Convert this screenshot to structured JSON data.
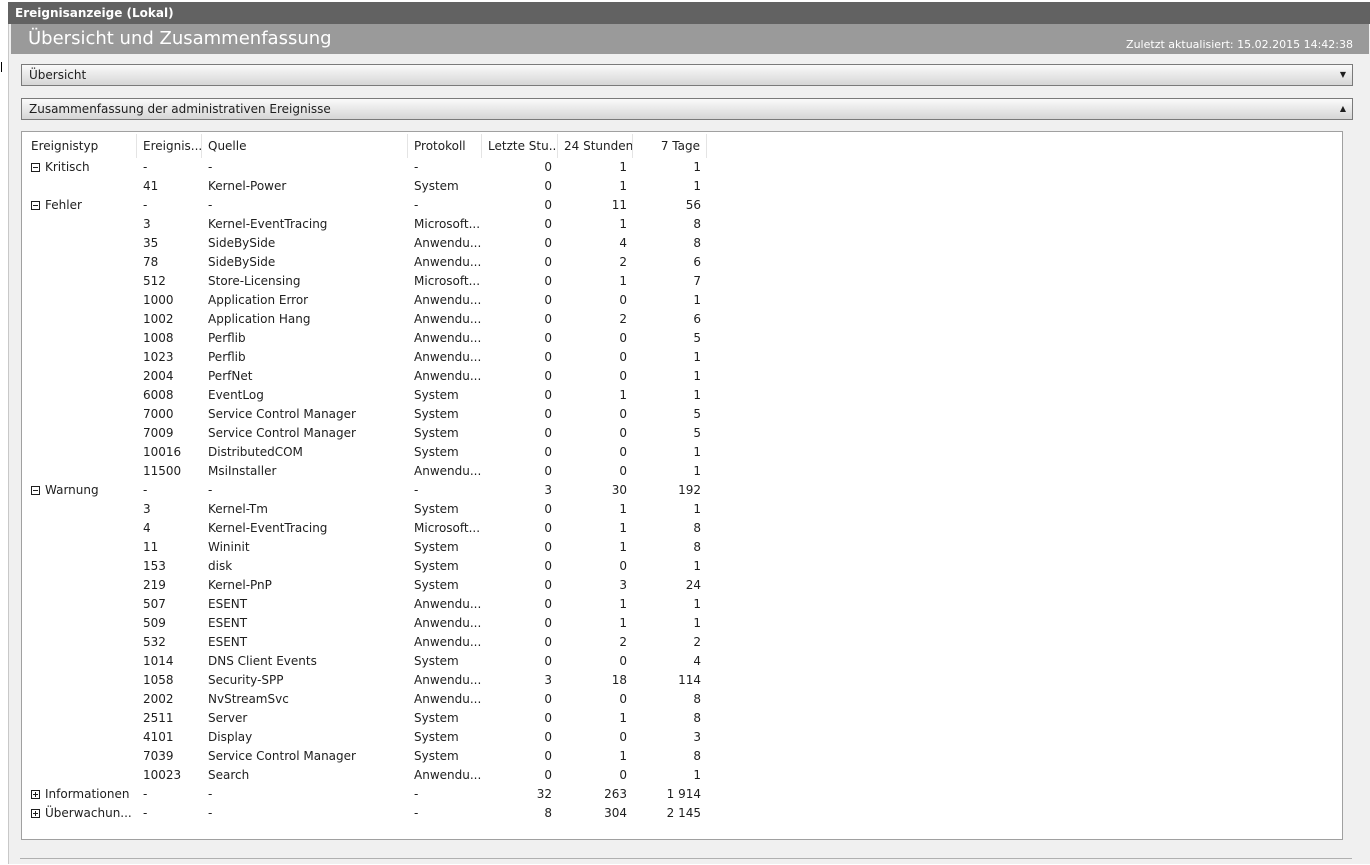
{
  "window": {
    "title": "Ereignisanzeige (Lokal)"
  },
  "banner": {
    "title": "Übersicht und Zusammenfassung",
    "updated": "Zuletzt aktualisiert: 15.02.2015 14:42:38"
  },
  "sections": {
    "overview": {
      "label": "Übersicht",
      "icon": "chevron-down-icon"
    },
    "summary": {
      "label": "Zusammenfassung der administrativen Ereignisse",
      "icon": "chevron-up-icon"
    }
  },
  "table": {
    "headers": [
      "Ereignistyp",
      "Ereignis...",
      "Quelle",
      "Protokoll",
      "Letzte Stu...",
      "24 Stunden",
      "7 Tage"
    ],
    "rows": [
      {
        "type": "Kritisch",
        "toggle": "minus",
        "id": "-",
        "source": "-",
        "log": "-",
        "hour": "0",
        "day": "1",
        "week": "1"
      },
      {
        "type": "",
        "toggle": "",
        "id": "41",
        "source": "Kernel-Power",
        "log": "System",
        "hour": "0",
        "day": "1",
        "week": "1"
      },
      {
        "type": "Fehler",
        "toggle": "minus",
        "id": "-",
        "source": "-",
        "log": "-",
        "hour": "0",
        "day": "11",
        "week": "56"
      },
      {
        "type": "",
        "toggle": "",
        "id": "3",
        "source": "Kernel-EventTracing",
        "log": "Microsoft...",
        "hour": "0",
        "day": "1",
        "week": "8"
      },
      {
        "type": "",
        "toggle": "",
        "id": "35",
        "source": "SideBySide",
        "log": "Anwendu...",
        "hour": "0",
        "day": "4",
        "week": "8"
      },
      {
        "type": "",
        "toggle": "",
        "id": "78",
        "source": "SideBySide",
        "log": "Anwendu...",
        "hour": "0",
        "day": "2",
        "week": "6"
      },
      {
        "type": "",
        "toggle": "",
        "id": "512",
        "source": "Store-Licensing",
        "log": "Microsoft...",
        "hour": "0",
        "day": "1",
        "week": "7"
      },
      {
        "type": "",
        "toggle": "",
        "id": "1000",
        "source": "Application Error",
        "log": "Anwendu...",
        "hour": "0",
        "day": "0",
        "week": "1"
      },
      {
        "type": "",
        "toggle": "",
        "id": "1002",
        "source": "Application Hang",
        "log": "Anwendu...",
        "hour": "0",
        "day": "2",
        "week": "6"
      },
      {
        "type": "",
        "toggle": "",
        "id": "1008",
        "source": "Perflib",
        "log": "Anwendu...",
        "hour": "0",
        "day": "0",
        "week": "5"
      },
      {
        "type": "",
        "toggle": "",
        "id": "1023",
        "source": "Perflib",
        "log": "Anwendu...",
        "hour": "0",
        "day": "0",
        "week": "1"
      },
      {
        "type": "",
        "toggle": "",
        "id": "2004",
        "source": "PerfNet",
        "log": "Anwendu...",
        "hour": "0",
        "day": "0",
        "week": "1"
      },
      {
        "type": "",
        "toggle": "",
        "id": "6008",
        "source": "EventLog",
        "log": "System",
        "hour": "0",
        "day": "1",
        "week": "1"
      },
      {
        "type": "",
        "toggle": "",
        "id": "7000",
        "source": "Service Control Manager",
        "log": "System",
        "hour": "0",
        "day": "0",
        "week": "5"
      },
      {
        "type": "",
        "toggle": "",
        "id": "7009",
        "source": "Service Control Manager",
        "log": "System",
        "hour": "0",
        "day": "0",
        "week": "5"
      },
      {
        "type": "",
        "toggle": "",
        "id": "10016",
        "source": "DistributedCOM",
        "log": "System",
        "hour": "0",
        "day": "0",
        "week": "1"
      },
      {
        "type": "",
        "toggle": "",
        "id": "11500",
        "source": "MsiInstaller",
        "log": "Anwendu...",
        "hour": "0",
        "day": "0",
        "week": "1"
      },
      {
        "type": "Warnung",
        "toggle": "minus",
        "id": "-",
        "source": "-",
        "log": "-",
        "hour": "3",
        "day": "30",
        "week": "192"
      },
      {
        "type": "",
        "toggle": "",
        "id": "3",
        "source": "Kernel-Tm",
        "log": "System",
        "hour": "0",
        "day": "1",
        "week": "1"
      },
      {
        "type": "",
        "toggle": "",
        "id": "4",
        "source": "Kernel-EventTracing",
        "log": "Microsoft...",
        "hour": "0",
        "day": "1",
        "week": "8"
      },
      {
        "type": "",
        "toggle": "",
        "id": "11",
        "source": "Wininit",
        "log": "System",
        "hour": "0",
        "day": "1",
        "week": "8"
      },
      {
        "type": "",
        "toggle": "",
        "id": "153",
        "source": "disk",
        "log": "System",
        "hour": "0",
        "day": "0",
        "week": "1"
      },
      {
        "type": "",
        "toggle": "",
        "id": "219",
        "source": "Kernel-PnP",
        "log": "System",
        "hour": "0",
        "day": "3",
        "week": "24"
      },
      {
        "type": "",
        "toggle": "",
        "id": "507",
        "source": "ESENT",
        "log": "Anwendu...",
        "hour": "0",
        "day": "1",
        "week": "1"
      },
      {
        "type": "",
        "toggle": "",
        "id": "509",
        "source": "ESENT",
        "log": "Anwendu...",
        "hour": "0",
        "day": "1",
        "week": "1"
      },
      {
        "type": "",
        "toggle": "",
        "id": "532",
        "source": "ESENT",
        "log": "Anwendu...",
        "hour": "0",
        "day": "2",
        "week": "2"
      },
      {
        "type": "",
        "toggle": "",
        "id": "1014",
        "source": "DNS Client Events",
        "log": "System",
        "hour": "0",
        "day": "0",
        "week": "4"
      },
      {
        "type": "",
        "toggle": "",
        "id": "1058",
        "source": "Security-SPP",
        "log": "Anwendu...",
        "hour": "3",
        "day": "18",
        "week": "114"
      },
      {
        "type": "",
        "toggle": "",
        "id": "2002",
        "source": "NvStreamSvc",
        "log": "Anwendu...",
        "hour": "0",
        "day": "0",
        "week": "8"
      },
      {
        "type": "",
        "toggle": "",
        "id": "2511",
        "source": "Server",
        "log": "System",
        "hour": "0",
        "day": "1",
        "week": "8"
      },
      {
        "type": "",
        "toggle": "",
        "id": "4101",
        "source": "Display",
        "log": "System",
        "hour": "0",
        "day": "0",
        "week": "3"
      },
      {
        "type": "",
        "toggle": "",
        "id": "7039",
        "source": "Service Control Manager",
        "log": "System",
        "hour": "0",
        "day": "1",
        "week": "8"
      },
      {
        "type": "",
        "toggle": "",
        "id": "10023",
        "source": "Search",
        "log": "Anwendu...",
        "hour": "0",
        "day": "0",
        "week": "1"
      },
      {
        "type": "Informationen",
        "toggle": "plus",
        "id": "-",
        "source": "-",
        "log": "-",
        "hour": "32",
        "day": "263",
        "week": "1 914"
      },
      {
        "type": "Überwachun...",
        "toggle": "plus",
        "id": "-",
        "source": "-",
        "log": "-",
        "hour": "8",
        "day": "304",
        "week": "2 145"
      }
    ]
  }
}
